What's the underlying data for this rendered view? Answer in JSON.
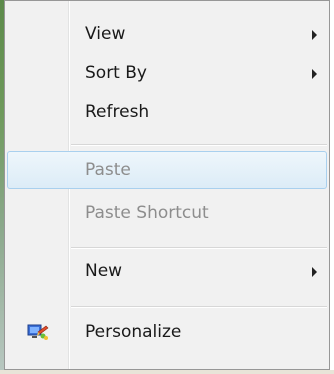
{
  "menu": {
    "items": [
      {
        "label": "View",
        "has_submenu": true,
        "enabled": true
      },
      {
        "label": "Sort By",
        "has_submenu": true,
        "enabled": true
      },
      {
        "label": "Refresh",
        "has_submenu": false,
        "enabled": true
      },
      {
        "label": "Paste",
        "has_submenu": false,
        "enabled": false,
        "highlighted": true
      },
      {
        "label": "Paste Shortcut",
        "has_submenu": false,
        "enabled": false
      },
      {
        "label": "New",
        "has_submenu": true,
        "enabled": true
      },
      {
        "label": "Personalize",
        "has_submenu": false,
        "enabled": true,
        "icon": "personalize-icon"
      }
    ]
  },
  "colors": {
    "menu_background": "#f1f1f1",
    "highlight_border": "#a9d0ee",
    "disabled_text": "#8d8d8d"
  }
}
